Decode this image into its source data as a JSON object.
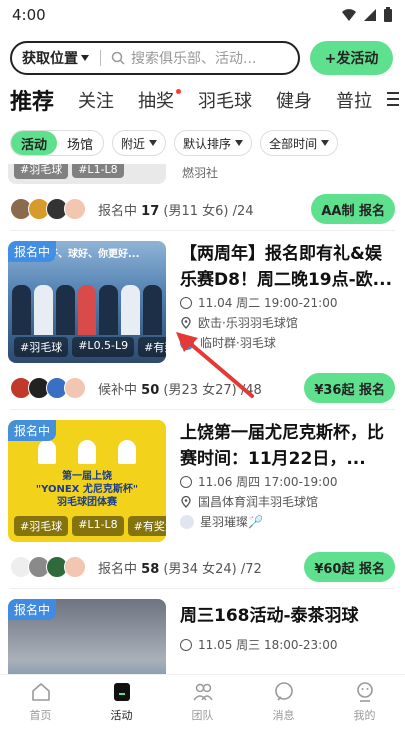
{
  "status": {
    "time": "4:00"
  },
  "topbar": {
    "location_label": "获取位置",
    "search_placeholder": "搜索俱乐部、活动...",
    "launch_button": "+发活动"
  },
  "tabs": [
    {
      "label": "推荐",
      "active": true
    },
    {
      "label": "关注"
    },
    {
      "label": "抽奖",
      "dot": true
    },
    {
      "label": "羽毛球"
    },
    {
      "label": "健身"
    },
    {
      "label": "普拉"
    }
  ],
  "filters": {
    "segment": [
      "活动",
      "场馆"
    ],
    "dropdowns": [
      "附近",
      "默认排序",
      "全部时间"
    ]
  },
  "partial": {
    "tags": [
      "#羽毛球",
      "#L1-L8"
    ],
    "org": "燃羽社",
    "signup_prefix": "报名中",
    "count": "17",
    "detail": " (男11 女6) /24",
    "button": "AA制 报名"
  },
  "cards": [
    {
      "badge": "报名中",
      "tags": [
        "#羽毛球",
        "#L0.5-L9",
        "#有奖"
      ],
      "title": "【两周年】报名即有礼&娱乐赛D8！周二晚19点-欧...",
      "time": "11.04 周二 19:00-21:00",
      "venue": "欧击·乐羽羽毛球馆",
      "org": "临时群·羽毛球",
      "signup_prefix": "候补中",
      "count": "50",
      "detail": " (男23 女27) /48",
      "button": "¥36起 报名",
      "img_text": "有好、球好、你更好..."
    },
    {
      "badge": "报名中",
      "tags": [
        "#羽毛球",
        "#L1-L8",
        "#有奖活"
      ],
      "title": "上饶第一届尤尼克斯杯，比赛时间：11月22日，...",
      "time": "11.06 周四 17:00-19:00",
      "venue": "国昌体育润丰羽毛球馆",
      "org": "星羽璀璨🏸",
      "signup_prefix": "报名中",
      "count": "58",
      "detail": " (男34 女24) /72",
      "button": "¥60起 报名",
      "img_text": "第一届上饶\n\"YONEX 尤尼克斯杯\"\n羽毛球团体赛"
    },
    {
      "badge": "报名中",
      "title": "周三168活动-泰茶羽球",
      "time": "11.05 周三 18:00-23:00"
    }
  ],
  "nav": [
    {
      "label": "首页"
    },
    {
      "label": "活动",
      "active": true
    },
    {
      "label": "团队"
    },
    {
      "label": "消息"
    },
    {
      "label": "我的"
    }
  ],
  "colors": {
    "accent": "#5fe08f",
    "badge": "#3c8ce6"
  }
}
